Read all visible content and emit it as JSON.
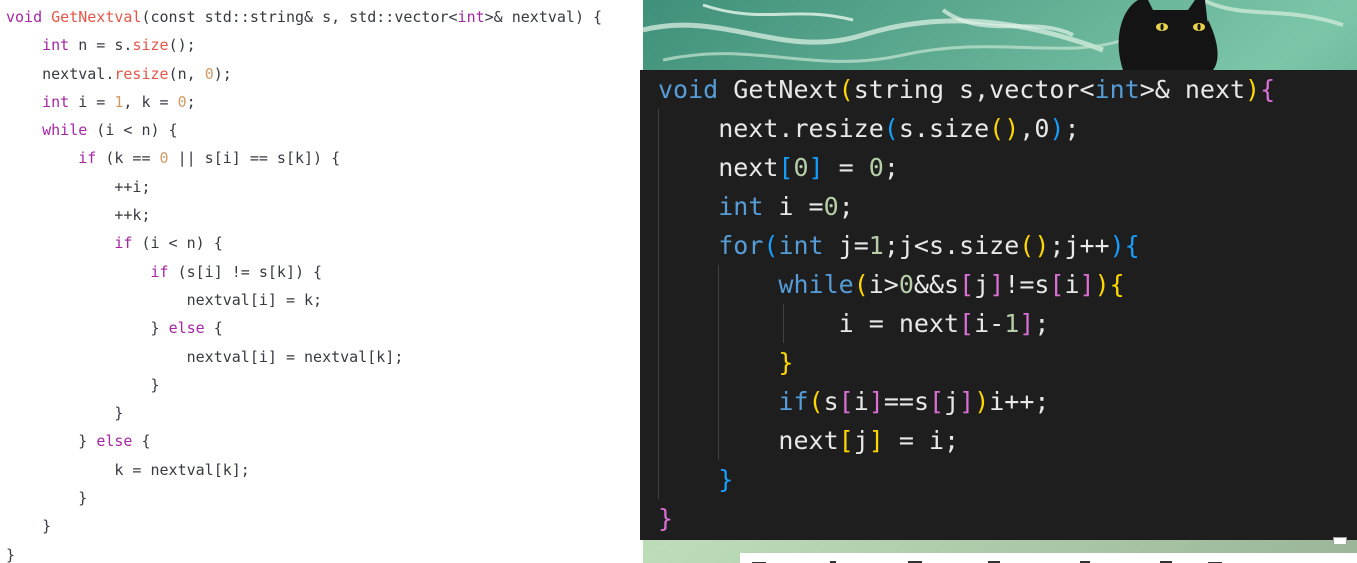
{
  "left_code": {
    "lines": [
      [
        [
          "void ",
          "lk"
        ],
        [
          "GetNextval",
          "lf"
        ],
        [
          "(const std::string& s, std::vector<",
          "lt"
        ],
        [
          "int",
          "lk"
        ],
        [
          ">& nextval) {",
          "lt"
        ]
      ],
      [
        [
          "    ",
          "lt"
        ],
        [
          "int",
          "lk"
        ],
        [
          " n = s.",
          "lt"
        ],
        [
          "size",
          "lf"
        ],
        [
          "();",
          "lt"
        ]
      ],
      [
        [
          "    nextval.",
          "lt"
        ],
        [
          "resize",
          "lf"
        ],
        [
          "(n, ",
          "lt"
        ],
        [
          "0",
          "ln"
        ],
        [
          ");",
          "lt"
        ]
      ],
      [
        [
          "    ",
          "lt"
        ],
        [
          "int",
          "lk"
        ],
        [
          " i = ",
          "lt"
        ],
        [
          "1",
          "ln"
        ],
        [
          ", k = ",
          "lt"
        ],
        [
          "0",
          "ln"
        ],
        [
          ";",
          "lt"
        ]
      ],
      [
        [
          "    ",
          "lt"
        ],
        [
          "while",
          "lk"
        ],
        [
          " (i < n) {",
          "lt"
        ]
      ],
      [
        [
          "        ",
          "lt"
        ],
        [
          "if",
          "lk"
        ],
        [
          " (k == ",
          "lt"
        ],
        [
          "0",
          "ln"
        ],
        [
          " || s[i] == s[k]) {",
          "lt"
        ]
      ],
      [
        [
          "            ++i;",
          "lt"
        ]
      ],
      [
        [
          "            ++k;",
          "lt"
        ]
      ],
      [
        [
          "            ",
          "lt"
        ],
        [
          "if",
          "lk"
        ],
        [
          " (i < n) {",
          "lt"
        ]
      ],
      [
        [
          "                ",
          "lt"
        ],
        [
          "if",
          "lk"
        ],
        [
          " (s[i] != s[k]) {",
          "lt"
        ]
      ],
      [
        [
          "                    nextval[i] = k;",
          "lt"
        ]
      ],
      [
        [
          "                } ",
          "lt"
        ],
        [
          "else",
          "lk"
        ],
        [
          " {",
          "lt"
        ]
      ],
      [
        [
          "                    nextval[i] = nextval[k];",
          "lt"
        ]
      ],
      [
        [
          "                }",
          "lt"
        ]
      ],
      [
        [
          "            }",
          "lt"
        ]
      ],
      [
        [
          "        } ",
          "lt"
        ],
        [
          "else",
          "lk"
        ],
        [
          " {",
          "lt"
        ]
      ],
      [
        [
          "            k = nextval[k];",
          "lt"
        ]
      ],
      [
        [
          "        }",
          "lt"
        ]
      ],
      [
        [
          "    }",
          "lt"
        ]
      ],
      [
        [
          "}",
          "lt"
        ]
      ]
    ]
  },
  "right_code": {
    "lines": [
      [
        [
          "void",
          "dk"
        ],
        [
          " GetNext",
          "dt"
        ],
        [
          "(",
          "b1"
        ],
        [
          "string s,vector<",
          "dt"
        ],
        [
          "int",
          "dk"
        ],
        [
          ">& next",
          "dt"
        ],
        [
          ")",
          "b1"
        ],
        [
          "{",
          "b2"
        ]
      ],
      [
        [
          "    next.resize",
          "dt"
        ],
        [
          "(",
          "b3"
        ],
        [
          "s.size",
          "dt"
        ],
        [
          "()",
          "b1"
        ],
        [
          ",0",
          "dt"
        ],
        [
          ")",
          "b3"
        ],
        [
          ";",
          "dt"
        ]
      ],
      [
        [
          "    next",
          "dt"
        ],
        [
          "[",
          "b3"
        ],
        [
          "0",
          "dn"
        ],
        [
          "]",
          "b3"
        ],
        [
          " = ",
          "dt"
        ],
        [
          "0",
          "dn"
        ],
        [
          ";",
          "dt"
        ]
      ],
      [
        [
          "    ",
          "dt"
        ],
        [
          "int",
          "dk"
        ],
        [
          " i =",
          "dt"
        ],
        [
          "0",
          "dn"
        ],
        [
          ";",
          "dt"
        ]
      ],
      [
        [
          "    ",
          "dt"
        ],
        [
          "for",
          "dc"
        ],
        [
          "(",
          "b3"
        ],
        [
          "int",
          "dk"
        ],
        [
          " j=",
          "dt"
        ],
        [
          "1",
          "dn"
        ],
        [
          ";j<s.size",
          "dt"
        ],
        [
          "()",
          "b1"
        ],
        [
          ";j++",
          "dt"
        ],
        [
          ")",
          "b3"
        ],
        [
          "{",
          "b3"
        ]
      ],
      [
        [
          "        ",
          "dt"
        ],
        [
          "while",
          "dc"
        ],
        [
          "(",
          "b1"
        ],
        [
          "i>",
          "dt"
        ],
        [
          "0",
          "dn"
        ],
        [
          "&&s",
          "dt"
        ],
        [
          "[",
          "b2"
        ],
        [
          "j",
          "dt"
        ],
        [
          "]",
          "b2"
        ],
        [
          "!=s",
          "dt"
        ],
        [
          "[",
          "b2"
        ],
        [
          "i",
          "dt"
        ],
        [
          "]",
          "b2"
        ],
        [
          ")",
          "b1"
        ],
        [
          "{",
          "b1"
        ]
      ],
      [
        [
          "            i = next",
          "dt"
        ],
        [
          "[",
          "b2"
        ],
        [
          "i-",
          "dt"
        ],
        [
          "1",
          "dn"
        ],
        [
          "]",
          "b2"
        ],
        [
          ";",
          "dt"
        ]
      ],
      [
        [
          "        ",
          "dt"
        ],
        [
          "}",
          "b1"
        ]
      ],
      [
        [
          "        ",
          "dt"
        ],
        [
          "if",
          "dc"
        ],
        [
          "(",
          "b1"
        ],
        [
          "s",
          "dt"
        ],
        [
          "[",
          "b2"
        ],
        [
          "i",
          "dt"
        ],
        [
          "]",
          "b2"
        ],
        [
          "==s",
          "dt"
        ],
        [
          "[",
          "b2"
        ],
        [
          "j",
          "dt"
        ],
        [
          "]",
          "b2"
        ],
        [
          ")",
          "b1"
        ],
        [
          "i++;",
          "dt"
        ]
      ],
      [
        [
          "        next",
          "dt"
        ],
        [
          "[",
          "b1"
        ],
        [
          "j",
          "dt"
        ],
        [
          "]",
          "b1"
        ],
        [
          " = i;",
          "dt"
        ]
      ],
      [
        [
          "    ",
          "dt"
        ],
        [
          "}",
          "b3"
        ]
      ],
      [
        [
          "}",
          "b2"
        ]
      ]
    ]
  },
  "colors": {
    "left_keyword": "#a626a4",
    "left_function": "#e45649",
    "left_number": "#d19a66",
    "dark_background": "#1e1e1e",
    "dark_keyword": "#569cd6",
    "dark_number": "#b5cea8",
    "bracket_gold": "#ffd700",
    "bracket_orchid": "#da70d6",
    "bracket_blue": "#179fff"
  },
  "icons": {
    "background": "anime-cat-illustration",
    "resize_handle": "window-corner-icon"
  }
}
